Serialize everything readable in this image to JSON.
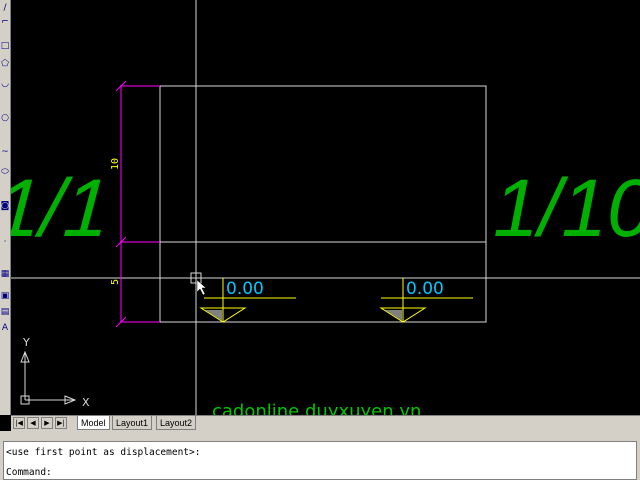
{
  "toolbar": {
    "icons": [
      "line-icon",
      "polyline-icon",
      "rectangle-icon",
      "polygon-icon",
      "arc-icon",
      "circle-icon",
      "spline-icon",
      "ellipse-icon",
      "insert-block-icon",
      "point-icon",
      "hatch-icon",
      "region-icon",
      "table-icon",
      "text-icon"
    ],
    "glyphs": [
      "/",
      "⌐",
      "□",
      "⬠",
      "◡",
      "○",
      "~",
      "⬭",
      "◙",
      "·",
      "▦",
      "▣",
      "▤",
      "A"
    ]
  },
  "drawing": {
    "large_labels": [
      "1/1",
      "1/10"
    ],
    "dim_vertical": [
      "10",
      "5"
    ],
    "elevations": [
      "0.00",
      "0.00"
    ],
    "ucs": {
      "x": "X",
      "y": "Y"
    },
    "watermark": "cadonline.duyxuyen.vn",
    "colors": {
      "geometry": "#d8d8d8",
      "dimension": "#ff00ff",
      "dim_text": "#ffff00",
      "labels": "#00c000",
      "elev": "#00c8ff",
      "watermark": "#00c800"
    }
  },
  "tabs": {
    "nav": [
      "|◀",
      "◀",
      "▶",
      "▶|"
    ],
    "items": [
      "Model",
      "Layout1",
      "Layout2"
    ]
  },
  "command": {
    "line1": "<use first point as displacement>:",
    "line2": "Command:"
  }
}
